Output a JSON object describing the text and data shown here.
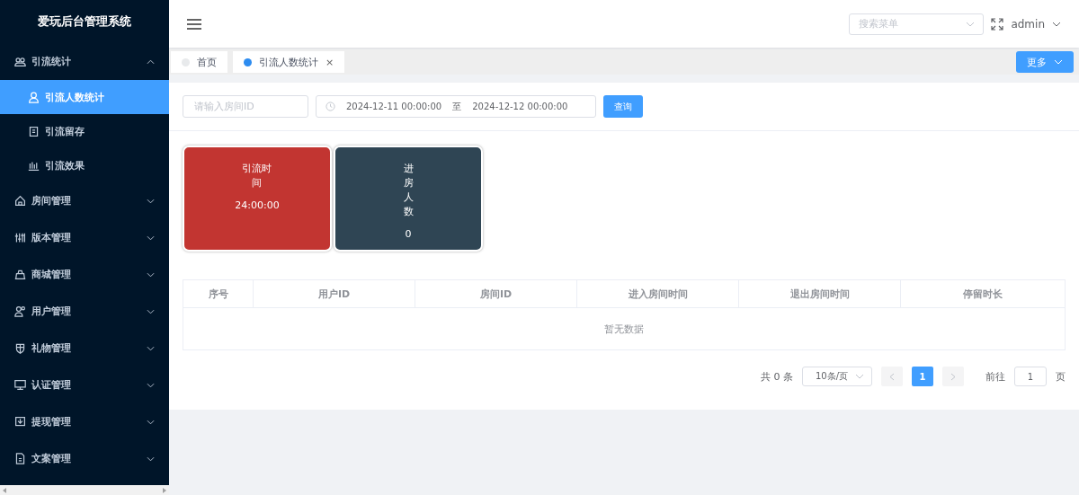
{
  "sidebar": {
    "title": "爱玩后台管理系统",
    "items": [
      {
        "label": "引流统计",
        "expanded": true,
        "children": [
          {
            "label": "引流人数统计",
            "selected": true
          },
          {
            "label": "引流留存",
            "selected": false
          },
          {
            "label": "引流效果",
            "selected": false
          }
        ]
      },
      {
        "label": "房间管理",
        "expanded": false
      },
      {
        "label": "版本管理",
        "expanded": false
      },
      {
        "label": "商城管理",
        "expanded": false
      },
      {
        "label": "用户管理",
        "expanded": false
      },
      {
        "label": "礼物管理",
        "expanded": false
      },
      {
        "label": "认证管理",
        "expanded": false
      },
      {
        "label": "提现管理",
        "expanded": false
      },
      {
        "label": "文案管理",
        "expanded": false
      }
    ]
  },
  "header": {
    "search": {
      "placeholder": "搜索菜单"
    },
    "user": "admin"
  },
  "tabs": [
    {
      "label": "首页",
      "selected": false
    },
    {
      "label": "引流人数统计",
      "selected": true,
      "close": "×"
    }
  ],
  "more_button": "更多",
  "filter": {
    "room_id": {
      "placeholder": "请输入房间ID"
    },
    "start": "2024-12-11 00:00:00",
    "separator": "至",
    "end": "2024-12-12 00:00:00",
    "query_button": "查询"
  },
  "cards": [
    {
      "title": "引流时间",
      "value": "24:00:00",
      "color": "#c23531"
    },
    {
      "title": "进房人数",
      "value": "0",
      "color": "#2f4554"
    }
  ],
  "table": {
    "columns": [
      "序号",
      "用户ID",
      "房间ID",
      "进入房间时间",
      "退出房间时间",
      "停留时长"
    ],
    "empty_text": "暂无数据"
  },
  "pagination": {
    "total": "共 0 条",
    "page_size": "10条/页",
    "pages": [
      {
        "label": "1",
        "selected": true
      }
    ],
    "goto_label": "前往",
    "goto_value": "1",
    "page_suffix": "页"
  }
}
